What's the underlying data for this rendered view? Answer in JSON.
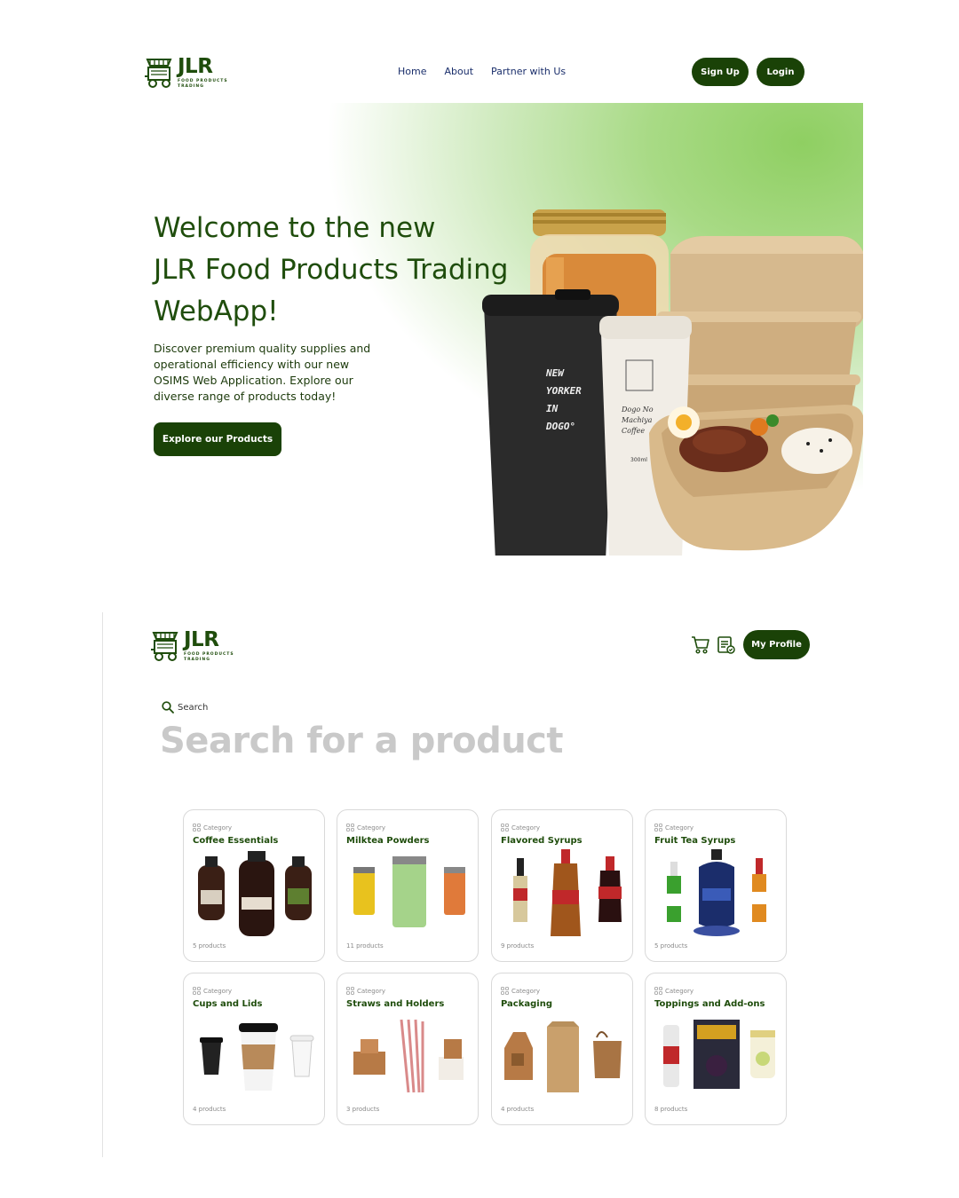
{
  "logo": {
    "name": "JLR",
    "tagline_line1": "FOOD PRODUCTS",
    "tagline_line2": "TRADING"
  },
  "landing": {
    "nav": [
      {
        "label": "Home"
      },
      {
        "label": "About"
      },
      {
        "label": "Partner with Us"
      }
    ],
    "signup_label": "Sign Up",
    "login_label": "Login",
    "hero_title_line1": "Welcome to the new",
    "hero_title_line2": "JLR Food Products Trading",
    "hero_title_line3": "WebApp!",
    "hero_description": "Discover premium quality supplies and operational efficiency with our new OSIMS Web Application. Explore our diverse range of products today!",
    "cta_label": "Explore our Products",
    "cup_text": [
      "NEW",
      "YORKER",
      "IN",
      "DOGO°"
    ],
    "cup2_text": [
      "Dogo No",
      "Machiya",
      "Coffee",
      "300ml"
    ]
  },
  "catalog": {
    "cart_icon": "cart-icon",
    "orders_icon": "order-list-icon",
    "profile_label": "My Profile",
    "search_label": "Search",
    "search_heading": "Search for a product",
    "category_label": "Category",
    "categories": [
      {
        "name": "Coffee Essentials",
        "count": "5 products"
      },
      {
        "name": "Milktea Powders",
        "count": "11 products"
      },
      {
        "name": "Flavored Syrups",
        "count": "9 products"
      },
      {
        "name": "Fruit Tea Syrups",
        "count": "5 products"
      },
      {
        "name": "Cups and Lids",
        "count": "4 products"
      },
      {
        "name": "Straws and Holders",
        "count": "3 products"
      },
      {
        "name": "Packaging",
        "count": "4 products"
      },
      {
        "name": "Toppings and Add-ons",
        "count": "8 products"
      }
    ]
  },
  "colors": {
    "primary": "#1a4207",
    "brand_text": "#1f4d0c",
    "nav_text": "#1a2e6b",
    "muted_heading": "#c9c9c9",
    "hero_green": "#8fcf62"
  }
}
